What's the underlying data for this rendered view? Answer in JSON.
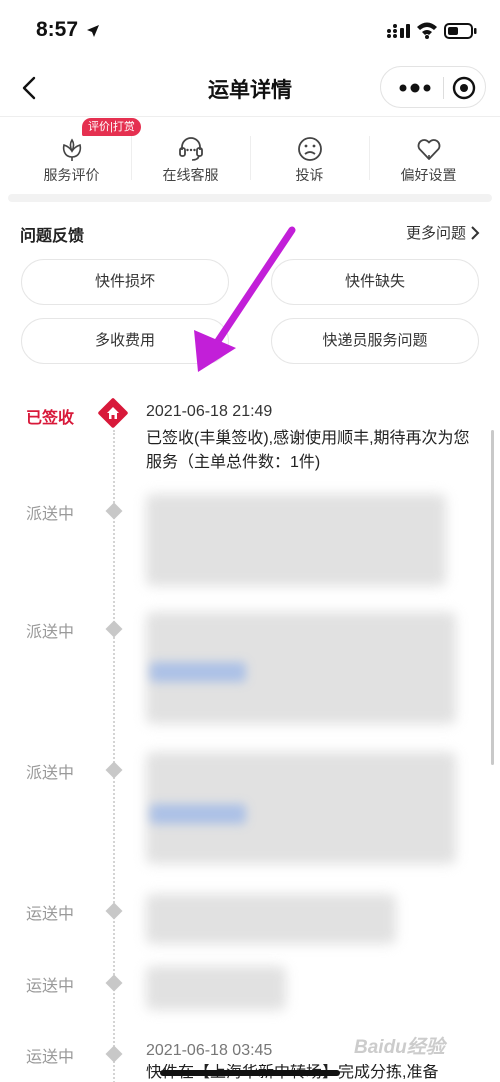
{
  "status_bar": {
    "time": "8:57"
  },
  "nav": {
    "title": "运单详情"
  },
  "services": [
    {
      "label": "服务评价",
      "badge": "评价|打赏"
    },
    {
      "label": "在线客服"
    },
    {
      "label": "投诉"
    },
    {
      "label": "偏好设置"
    }
  ],
  "feedback": {
    "title": "问题反馈",
    "more": "更多问题",
    "chips": [
      "快件损坏",
      "快件缺失",
      "多收费用",
      "快递员服务问题"
    ]
  },
  "timeline": [
    {
      "status": "已签收",
      "time": "2021-06-18 21:49",
      "desc": "已签收(丰巢签收),感谢使用顺丰,期待再次为您服务（主单总件数：1件)"
    },
    {
      "status": "派送中"
    },
    {
      "status": "派送中"
    },
    {
      "status": "派送中"
    },
    {
      "status": "运送中"
    },
    {
      "status": "运送中"
    },
    {
      "status": "运送中",
      "time": "2021-06-18 03:45",
      "desc": "快件在【上海华新中转场】完成分拣,准备"
    }
  ],
  "watermark": "Baidu经验",
  "colors": {
    "accent": "#d8193a",
    "badge": "#e53050",
    "arrow": "#c21fd8"
  }
}
